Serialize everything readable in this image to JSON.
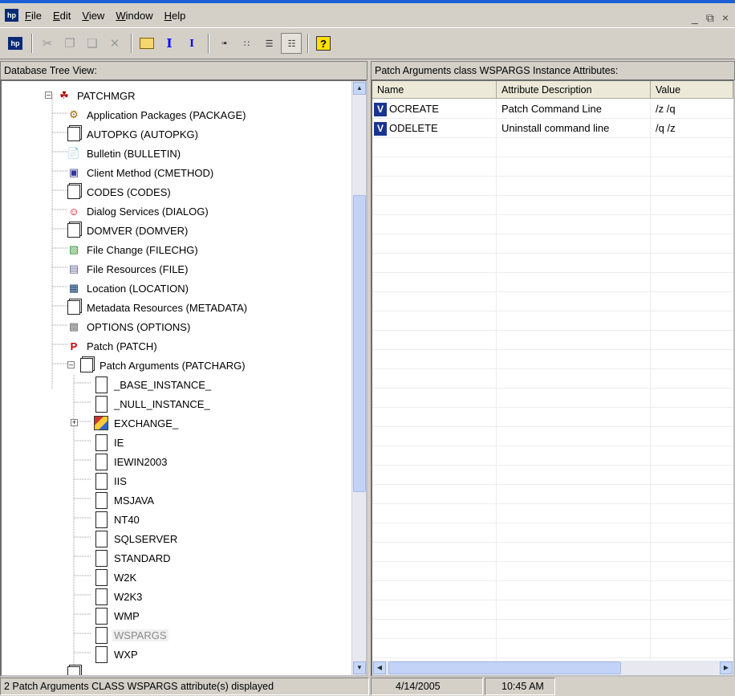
{
  "menu": {
    "items": [
      "File",
      "Edit",
      "View",
      "Window",
      "Help"
    ],
    "minimize": "_",
    "restore": "á",
    "close": "×"
  },
  "toolbar": {
    "buttons": [
      "app-logo",
      "cut",
      "copy",
      "paste",
      "delete",
      "open-folder",
      "instance-view",
      "class-view",
      "large-icons",
      "small-icons",
      "list-view",
      "details-view",
      "help"
    ]
  },
  "left_pane": {
    "title": "Database Tree View:"
  },
  "tree": {
    "root": "PATCHMGR",
    "classes": [
      "Application Packages (PACKAGE)",
      "AUTOPKG (AUTOPKG)",
      "Bulletin (BULLETIN)",
      "Client Method (CMETHOD)",
      "CODES (CODES)",
      "Dialog Services (DIALOG)",
      "DOMVER (DOMVER)",
      "File Change (FILECHG)",
      "File Resources (FILE)",
      "Location (LOCATION)",
      "Metadata Resources (METADATA)",
      "OPTIONS (OPTIONS)",
      "Patch (PATCH)",
      "Patch Arguments (PATCHARG)"
    ],
    "instances": [
      "_BASE_INSTANCE_",
      "_NULL_INSTANCE_",
      "EXCHANGE_",
      "IE",
      "IEWIN2003",
      "IIS",
      "MSJAVA",
      "NT40",
      "SQLSERVER",
      "STANDARD",
      "W2K",
      "W2K3",
      "WMP",
      "WSPARGS",
      "WXP"
    ],
    "selected": "WSPARGS"
  },
  "right_pane": {
    "title": "Patch Arguments class WSPARGS Instance Attributes:"
  },
  "grid": {
    "columns": [
      "Name",
      "Attribute Description",
      "Value"
    ],
    "rows": [
      {
        "icon": "V",
        "name": "OCREATE",
        "description": "Patch Command Line",
        "value": "/z /q"
      },
      {
        "icon": "V",
        "name": "ODELETE",
        "description": "Uninstall command line",
        "value": "/q /z"
      }
    ]
  },
  "status": {
    "message": "2 Patch Arguments CLASS WSPARGS attribute(s) displayed",
    "date": "4/14/2005",
    "time": "10:45 AM"
  }
}
